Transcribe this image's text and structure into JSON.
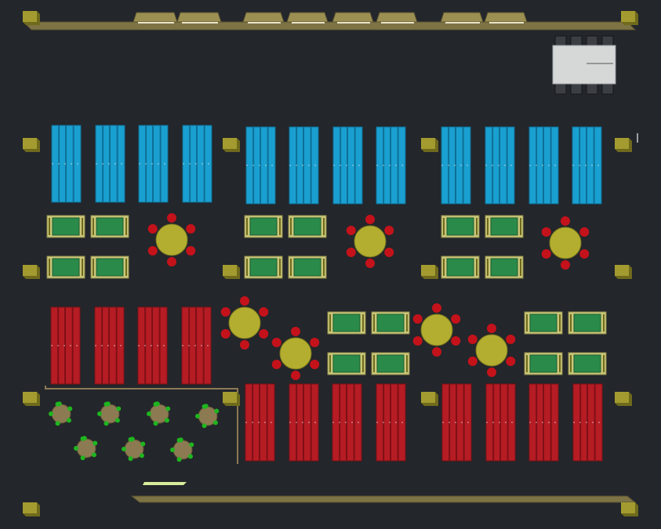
{
  "scene": {
    "name": "top-down-room-layout",
    "colors": {
      "floor": "#23262b",
      "wall": "#7d7345",
      "wall_edge": "#5a5230",
      "pillar": "#a39b2f",
      "pillar_side": "#6f6a1c",
      "blue_module": "#1aa0d0",
      "blue_stripe": "#0e6f96",
      "red_module": "#b61c24",
      "red_stripe": "#7e1016",
      "green_box": "#2a8a4a",
      "green_box_frame": "#cbc77a",
      "round_table": "#b3ae30",
      "chair_red": "#c4121b",
      "planter": "#8c7a52",
      "leaf": "#1fb51f",
      "fridge_body": "#d6d8d8",
      "fridge_dark": "#3b3f44",
      "fence": "#8c7a55",
      "mat": "#d8ec9a"
    },
    "counts": {
      "blue_modules": 12,
      "red_modules": 16,
      "green_boxes": 20,
      "round_tables": 7,
      "planters": 7,
      "pillars": 16
    }
  }
}
